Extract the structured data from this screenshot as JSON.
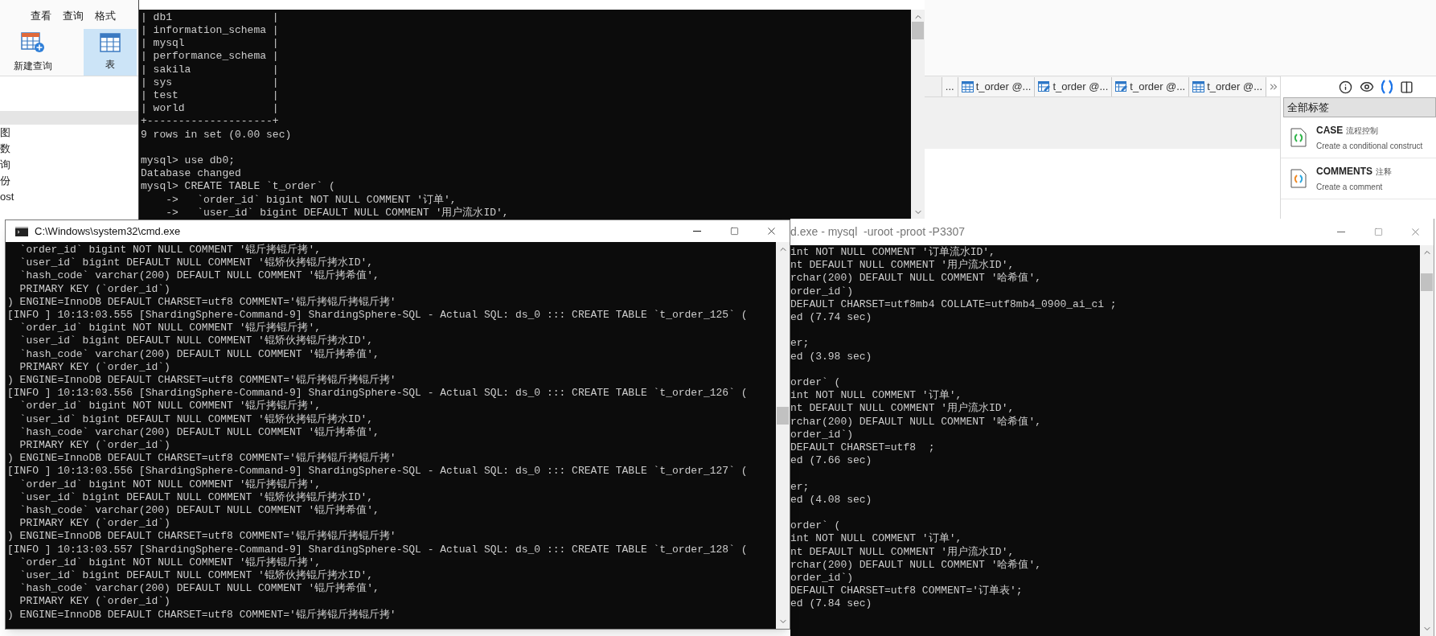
{
  "navicat": {
    "menu": [
      "查看",
      "查询",
      "格式"
    ],
    "toolbar": [
      {
        "label": "新建查询",
        "kind": "new-query",
        "selected": false
      },
      {
        "label": "表",
        "kind": "table",
        "selected": true
      }
    ],
    "sidebar": [
      "图",
      "数",
      "询",
      "份",
      "ost"
    ],
    "tabs": [
      {
        "label": "...",
        "kind": "none"
      },
      {
        "label": "t_order @...",
        "kind": "table"
      },
      {
        "label": "t_order @...",
        "kind": "design"
      },
      {
        "label": "t_order @...",
        "kind": "design"
      },
      {
        "label": "t_order @...",
        "kind": "table"
      }
    ],
    "panel": {
      "tools": [
        {
          "kind": "info",
          "selected": false
        },
        {
          "kind": "preview",
          "selected": false
        },
        {
          "kind": "snippets",
          "selected": true
        },
        {
          "kind": "layout",
          "selected": false
        }
      ],
      "filter": "全部标签",
      "snippets": [
        {
          "title": "CASE",
          "tag": "流程控制",
          "description": "Create a conditional construct",
          "kind": "case"
        },
        {
          "title": "COMMENTS",
          "tag": "注释",
          "description": "Create a comment",
          "kind": "comment"
        }
      ]
    }
  },
  "top_console": {
    "blocks": [
      [
        "| db1                |",
        "| information_schema |",
        "| mysql              |",
        "| performance_schema |",
        "| sakila             |",
        "| sys                |",
        "| test               |",
        "| world              |",
        "+--------------------+",
        "9 rows in set (0.00 sec)"
      ],
      [
        "mysql> use db0;",
        "Database changed",
        "mysql> CREATE TABLE `t_order` (",
        "    ->   `order_id` bigint NOT NULL COMMENT '订单',",
        "    ->   `user_id` bigint DEFAULT NULL COMMENT '用户流水ID',"
      ]
    ]
  },
  "left_console": {
    "title": "C:\\Windows\\system32\\cmd.exe",
    "lines": [
      "  `order_id` bigint NOT NULL COMMENT '锟斤拷锟斤拷',",
      "  `user_id` bigint DEFAULT NULL COMMENT '锟矫伙拷锟斤拷水ID',",
      "  `hash_code` varchar(200) DEFAULT NULL COMMENT '锟斤拷希值',",
      "  PRIMARY KEY (`order_id`)",
      ") ENGINE=InnoDB DEFAULT CHARSET=utf8 COMMENT='锟斤拷锟斤拷锟斤拷'",
      "[INFO ] 10:13:03.555 [ShardingSphere-Command-9] ShardingSphere-SQL - Actual SQL: ds_0 ::: CREATE TABLE `t_order_125` (",
      "  `order_id` bigint NOT NULL COMMENT '锟斤拷锟斤拷',",
      "  `user_id` bigint DEFAULT NULL COMMENT '锟矫伙拷锟斤拷水ID',",
      "  `hash_code` varchar(200) DEFAULT NULL COMMENT '锟斤拷希值',",
      "  PRIMARY KEY (`order_id`)",
      ") ENGINE=InnoDB DEFAULT CHARSET=utf8 COMMENT='锟斤拷锟斤拷锟斤拷'",
      "[INFO ] 10:13:03.556 [ShardingSphere-Command-9] ShardingSphere-SQL - Actual SQL: ds_0 ::: CREATE TABLE `t_order_126` (",
      "  `order_id` bigint NOT NULL COMMENT '锟斤拷锟斤拷',",
      "  `user_id` bigint DEFAULT NULL COMMENT '锟矫伙拷锟斤拷水ID',",
      "  `hash_code` varchar(200) DEFAULT NULL COMMENT '锟斤拷希值',",
      "  PRIMARY KEY (`order_id`)",
      ") ENGINE=InnoDB DEFAULT CHARSET=utf8 COMMENT='锟斤拷锟斤拷锟斤拷'",
      "[INFO ] 10:13:03.556 [ShardingSphere-Command-9] ShardingSphere-SQL - Actual SQL: ds_0 ::: CREATE TABLE `t_order_127` (",
      "  `order_id` bigint NOT NULL COMMENT '锟斤拷锟斤拷',",
      "  `user_id` bigint DEFAULT NULL COMMENT '锟矫伙拷锟斤拷水ID',",
      "  `hash_code` varchar(200) DEFAULT NULL COMMENT '锟斤拷希值',",
      "  PRIMARY KEY (`order_id`)",
      ") ENGINE=InnoDB DEFAULT CHARSET=utf8 COMMENT='锟斤拷锟斤拷锟斤拷'",
      "[INFO ] 10:13:03.557 [ShardingSphere-Command-9] ShardingSphere-SQL - Actual SQL: ds_0 ::: CREATE TABLE `t_order_128` (",
      "  `order_id` bigint NOT NULL COMMENT '锟斤拷锟斤拷',",
      "  `user_id` bigint DEFAULT NULL COMMENT '锟矫伙拷锟斤拷水ID',",
      "  `hash_code` varchar(200) DEFAULT NULL COMMENT '锟斤拷希值',",
      "  PRIMARY KEY (`order_id`)",
      ") ENGINE=InnoDB DEFAULT CHARSET=utf8 COMMENT='锟斤拷锟斤拷锟斤拷'"
    ]
  },
  "right_console": {
    "title": "d.exe - mysql  -uroot -proot -P3307",
    "blocks": [
      [
        "int NOT NULL COMMENT '订单流水ID',",
        "nt DEFAULT NULL COMMENT '用户流水ID',",
        "rchar(200) DEFAULT NULL COMMENT '哈希值',",
        "order_id`)",
        "DEFAULT CHARSET=utf8mb4 COLLATE=utf8mb4_0900_ai_ci ;",
        "ed (7.74 sec)"
      ],
      [
        "er;",
        "ed (3.98 sec)"
      ],
      [
        "order` (",
        "int NOT NULL COMMENT '订单',",
        "nt DEFAULT NULL COMMENT '用户流水ID',",
        "rchar(200) DEFAULT NULL COMMENT '哈希值',",
        "order_id`)",
        "DEFAULT CHARSET=utf8  ;",
        "ed (7.66 sec)"
      ],
      [
        "er;",
        "ed (4.08 sec)"
      ],
      [
        "order` (",
        "int NOT NULL COMMENT '订单',",
        "nt DEFAULT NULL COMMENT '用户流水ID',",
        "rchar(200) DEFAULT NULL COMMENT '哈希值',",
        "order_id`)",
        "DEFAULT CHARSET=utf8 COMMENT='订单表';",
        "ed (7.84 sec)"
      ]
    ]
  }
}
